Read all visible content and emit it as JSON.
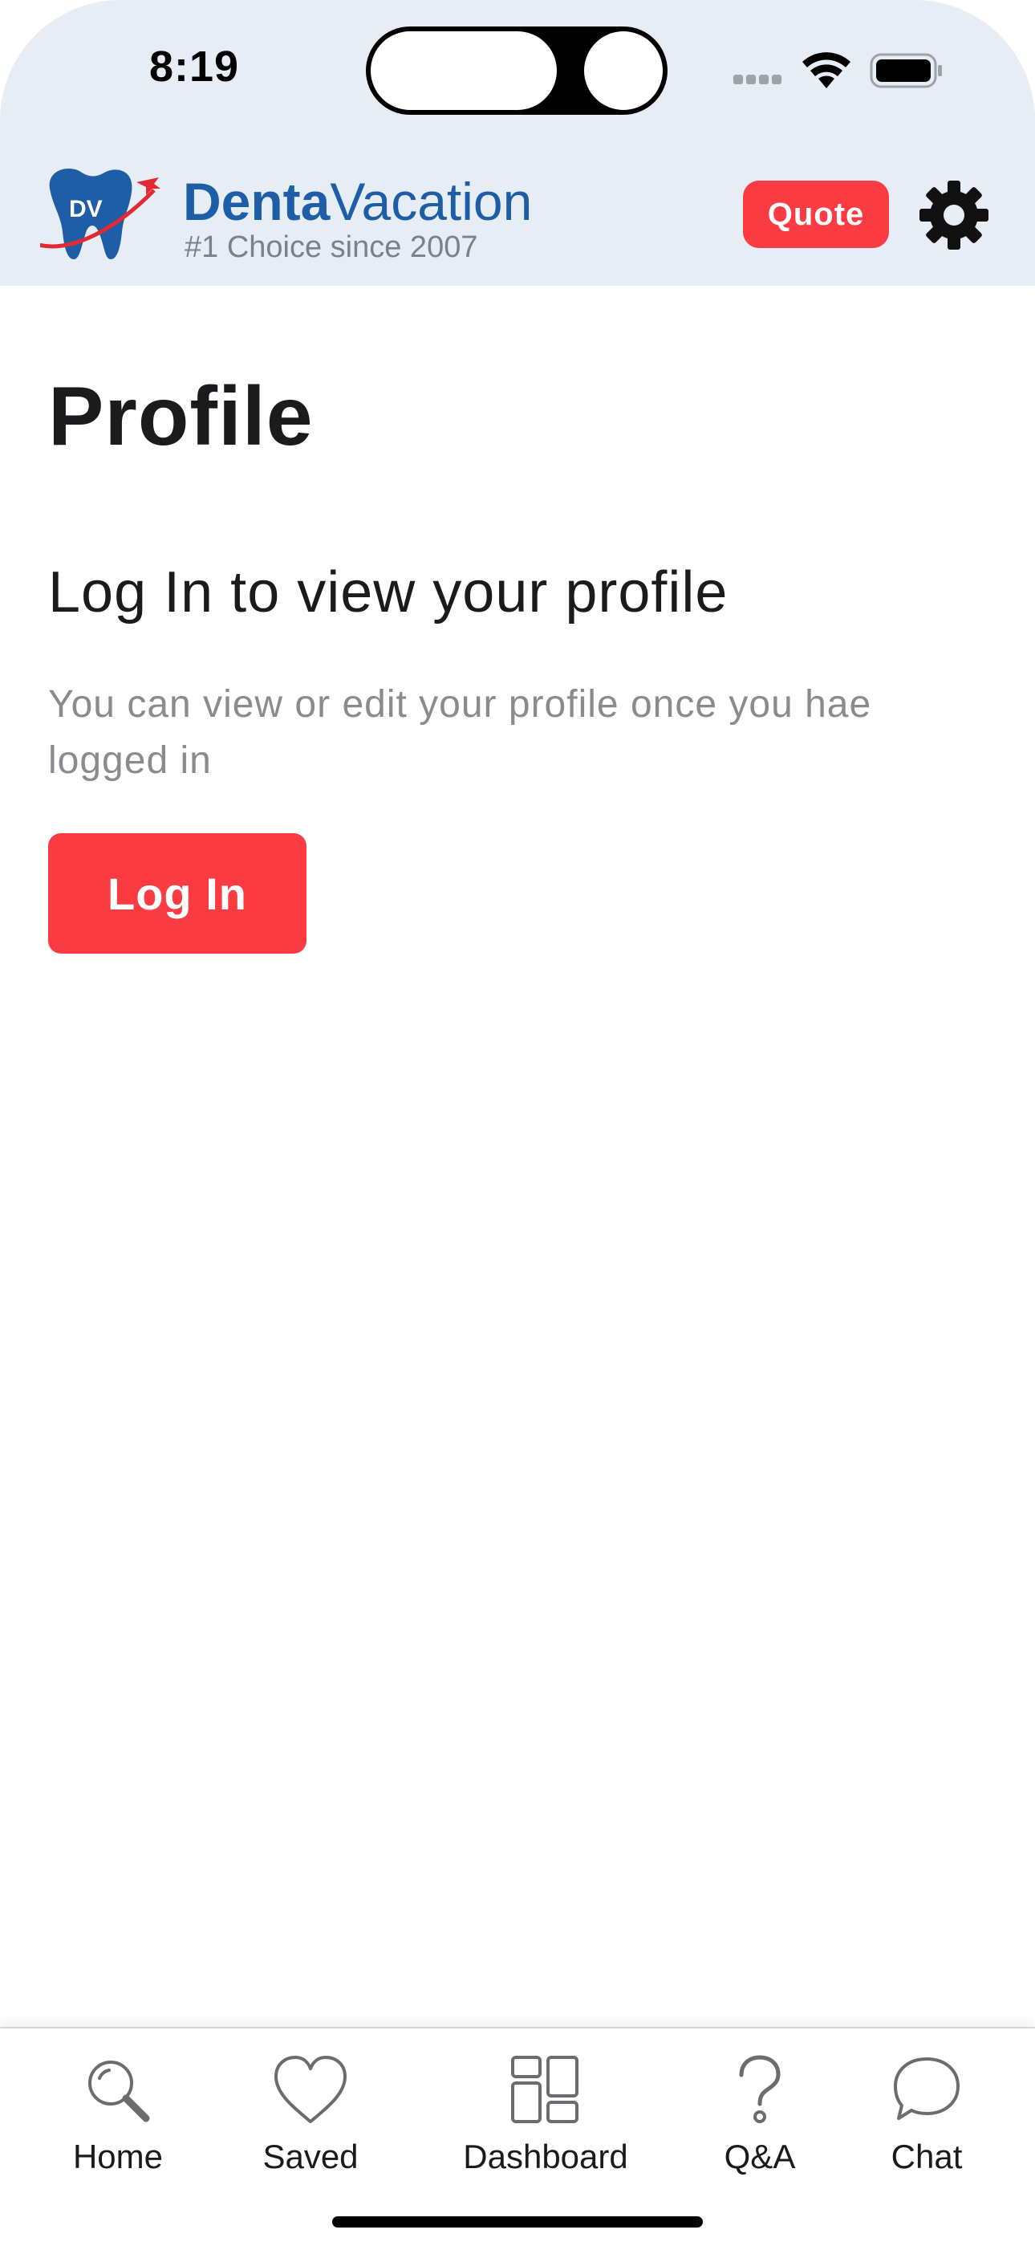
{
  "status_bar": {
    "time": "8:19"
  },
  "header": {
    "logo_text": "DV",
    "brand_bold": "Denta",
    "brand_light": "Vacation",
    "tagline": "#1 Choice since 2007",
    "quote_label": "Quote",
    "settings_icon": "gear-icon"
  },
  "main": {
    "title": "Profile",
    "login_heading": "Log In to view your profile",
    "login_description": "You can view or edit your profile once you hae logged in",
    "login_button": "Log In"
  },
  "tabs": [
    {
      "label": "Home",
      "icon": "search-icon"
    },
    {
      "label": "Saved",
      "icon": "heart-icon"
    },
    {
      "label": "Dashboard",
      "icon": "dashboard-icon"
    },
    {
      "label": "Q&A",
      "icon": "question-icon"
    },
    {
      "label": "Chat",
      "icon": "chat-bubble-icon"
    }
  ],
  "colors": {
    "accent_red": "#fb3b42",
    "brand_blue": "#1e5ea7",
    "header_bg": "#e6edf5"
  }
}
